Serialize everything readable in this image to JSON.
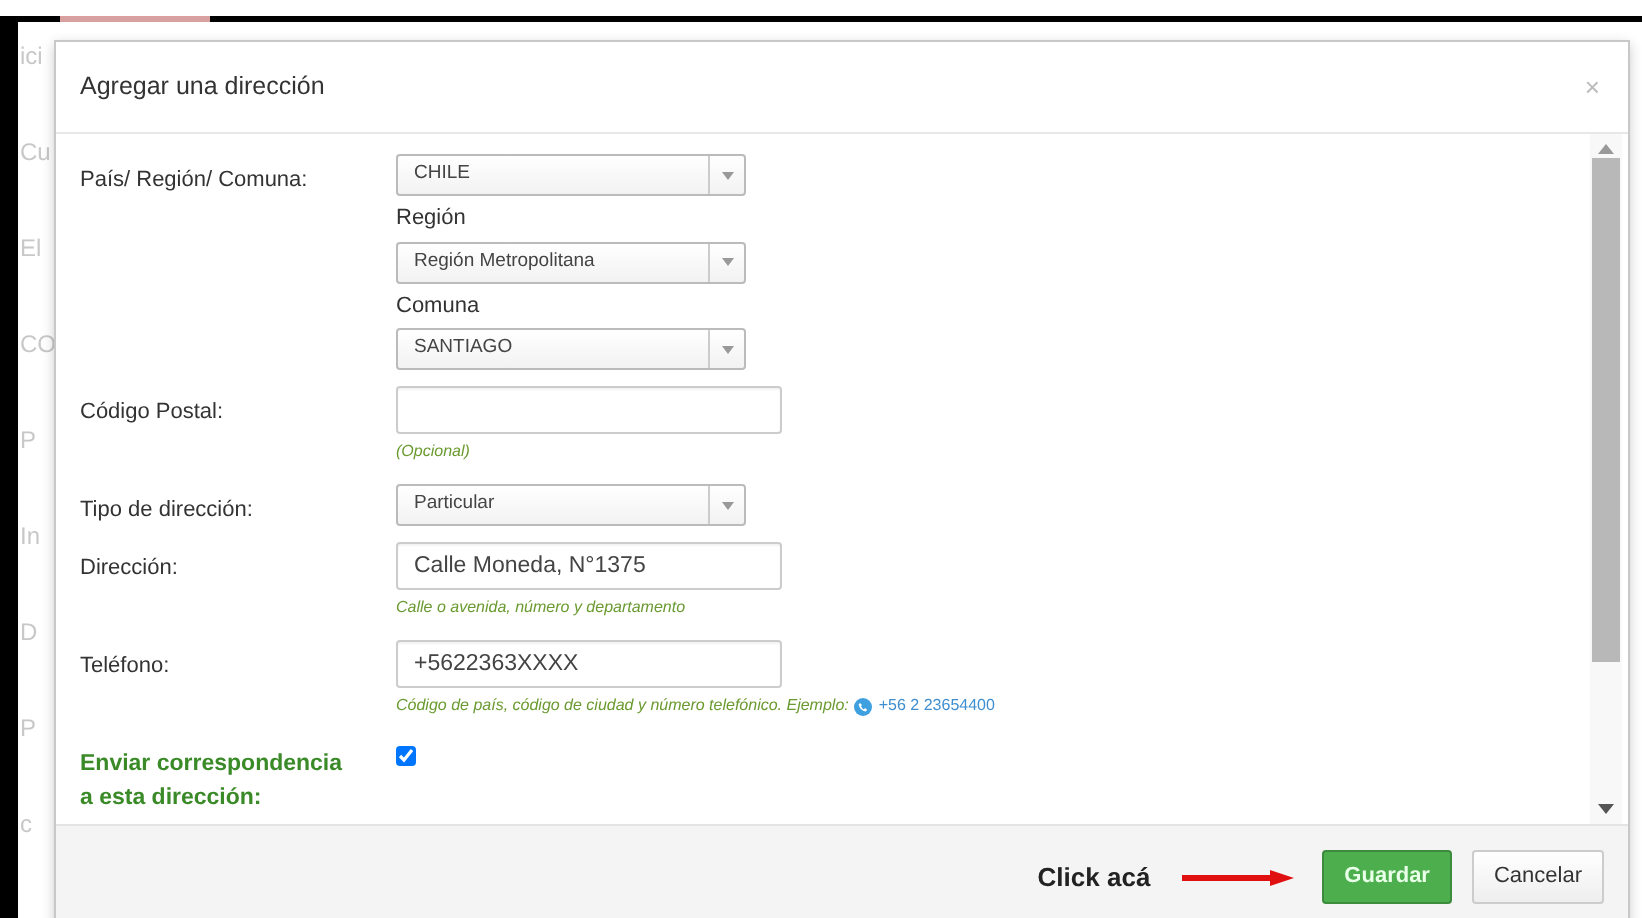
{
  "background_fragments": [
    "ici",
    "Cu",
    "El",
    "CO",
    "P",
    "In",
    "D",
    "P",
    "c"
  ],
  "modal": {
    "title": "Agregar una dirección",
    "close": "×",
    "fields": [
      {
        "label": "País/ Región/ Comuna:",
        "emphasis": false,
        "controls": [
          {
            "kind": "select",
            "value": "CHILE"
          },
          {
            "kind": "caption",
            "text": "Región"
          },
          {
            "kind": "select",
            "value": "Región Metropolitana"
          },
          {
            "kind": "caption",
            "text": "Comuna"
          },
          {
            "kind": "select",
            "value": "SANTIAGO"
          }
        ]
      },
      {
        "label": "Código Postal:",
        "emphasis": false,
        "controls": [
          {
            "kind": "input"
          },
          {
            "kind": "help",
            "text": "(Opcional)"
          }
        ]
      },
      {
        "label": "Tipo de dirección:",
        "emphasis": false,
        "controls": [
          {
            "kind": "select",
            "value": "Particular"
          }
        ]
      },
      {
        "label": "Dirección:",
        "emphasis": false,
        "controls": [
          {
            "kind": "input",
            "value": "Calle Moneda, N°1375"
          },
          {
            "kind": "help",
            "text": "Calle o avenida, número y departamento"
          }
        ]
      },
      {
        "label": "Teléfono:",
        "emphasis": false,
        "controls": [
          {
            "kind": "input",
            "value": "+5622363XXXX"
          },
          {
            "kind": "help",
            "text": "Código de país, código de ciudad y número telefónico. Ejemplo:",
            "example": "+56 2 23654400"
          }
        ]
      },
      {
        "label": "Enviar correspondencia a esta dirección:",
        "emphasis": true,
        "controls": [
          {
            "kind": "checkbox",
            "checked": true
          }
        ]
      }
    ],
    "annotation": "Click acá",
    "buttons": [
      {
        "label": "Guardar",
        "kind": "primary"
      },
      {
        "label": "Cancelar",
        "kind": "secondary"
      }
    ]
  }
}
